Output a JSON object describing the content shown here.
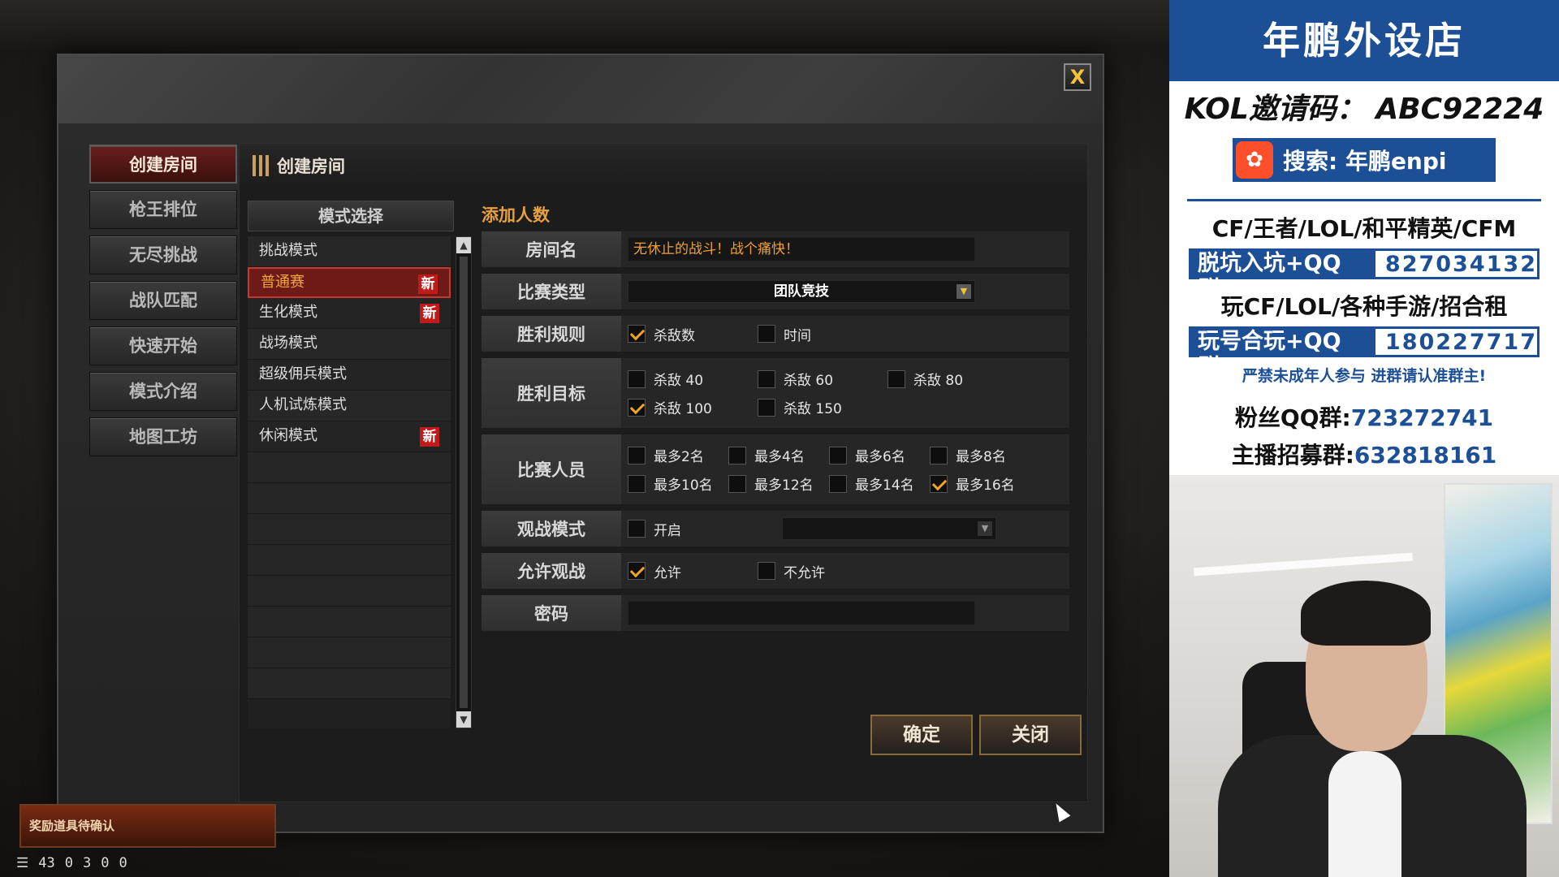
{
  "dialog": {
    "close_symbol": "X",
    "side_menu": [
      "创建房间",
      "枪王排位",
      "无尽挑战",
      "战队匹配",
      "快速开始",
      "模式介绍",
      "地图工坊"
    ],
    "panel_title": "创建房间",
    "mode_header": "模式选择",
    "modes": [
      {
        "label": "挑战模式",
        "new": ""
      },
      {
        "label": "普通赛",
        "new": "新"
      },
      {
        "label": "生化模式",
        "new": "新"
      },
      {
        "label": "战场模式",
        "new": ""
      },
      {
        "label": "超级佣兵模式",
        "new": ""
      },
      {
        "label": "人机试炼模式",
        "new": ""
      },
      {
        "label": "休闲模式",
        "new": "新"
      }
    ],
    "form_heading": "添加人数",
    "fields": {
      "room_name_label": "房间名",
      "room_name_value": "无休止的战斗！战个痛快！",
      "match_type_label": "比赛类型",
      "match_type_value": "团队竞技",
      "win_rule_label": "胜利规则",
      "win_rule_kills": "杀敌数",
      "win_rule_time": "时间",
      "win_target_label": "胜利目标",
      "kill_40": "杀敌 40",
      "kill_60": "杀敌 60",
      "kill_80": "杀敌 80",
      "kill_100": "杀敌 100",
      "kill_150": "杀敌 150",
      "players_label": "比赛人员",
      "max2": "最多2名",
      "max4": "最多4名",
      "max6": "最多6名",
      "max8": "最多8名",
      "max10": "最多10名",
      "max12": "最多12名",
      "max14": "最多14名",
      "max16": "最多16名",
      "spectate_mode_label": "观战模式",
      "spectate_on": "开启",
      "allow_spectate_label": "允许观战",
      "allow": "允许",
      "disallow": "不允许",
      "password_label": "密码"
    },
    "ok_button": "确定",
    "close_button": "关闭"
  },
  "notification": "奖励道具待确认",
  "statusbar": [
    "☰",
    "43",
    "0",
    "3",
    "0",
    "0"
  ],
  "overlay": {
    "banner": "年鹏外设店",
    "kol": "KOL邀请码： ABC92224",
    "search": "搜索: 年鹏enpi",
    "line1": "CF/王者/LOL/和平精英/CFM",
    "box1_label": "脱坑入坑+QQ群:",
    "box1_value": "827034132",
    "line2": "玩CF/LOL/各种手游/招合租",
    "box2_label": "玩号合玩+QQ群:",
    "box2_value": "180227717",
    "warning": "严禁未成年人参与   进群请认准群主!",
    "fan_label": "粉丝QQ群:",
    "fan_value": "723272741",
    "host_label": "主播招募群:",
    "host_value": "632818161"
  }
}
